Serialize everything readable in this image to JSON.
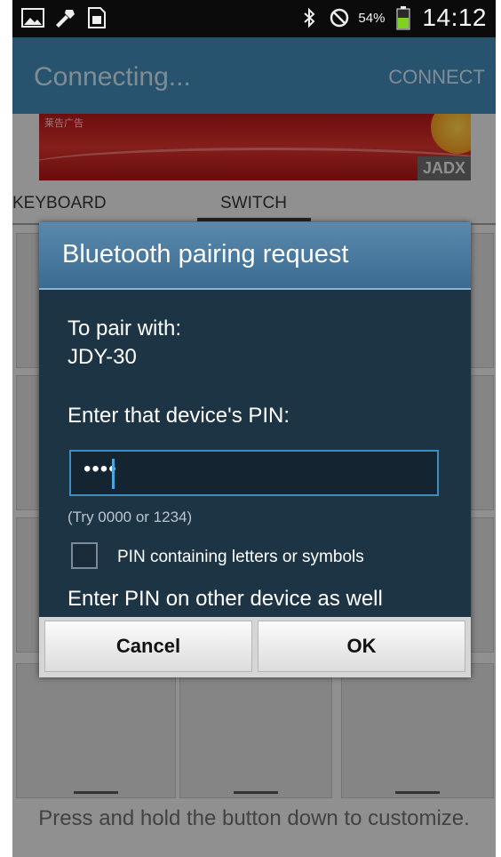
{
  "status_bar": {
    "icons": [
      "image-icon",
      "tools-icon",
      "sim-icon"
    ],
    "right_icons": [
      "bluetooth-icon",
      "do-not-disturb-icon",
      "battery-icon"
    ],
    "battery_percent": "54%",
    "time": "14:12"
  },
  "action_bar": {
    "title": "Connecting...",
    "connect_label": "CONNECT"
  },
  "banner": {
    "label": "莱告广告",
    "badge": "JADX"
  },
  "tabs": [
    {
      "label": "KEYBOARD"
    },
    {
      "label": "SWITCH"
    }
  ],
  "footer": {
    "hint": "Press and hold the button down to customize."
  },
  "dialog": {
    "title": "Bluetooth pairing request",
    "pair_with_label": "To pair with:",
    "device_name": "JDY-30",
    "enter_pin_label": "Enter that device's PIN:",
    "pin_value": "••••",
    "hint": "(Try 0000 or 1234)",
    "checkbox_label": "PIN containing letters or symbols",
    "checkbox_checked": false,
    "other_device_note": "Enter PIN on other device as well",
    "cancel_label": "Cancel",
    "ok_label": "OK"
  },
  "colors": {
    "action_bar": "#3f86b3",
    "dialog_bg": "#1d3444",
    "input_border": "#3e8fc0"
  }
}
